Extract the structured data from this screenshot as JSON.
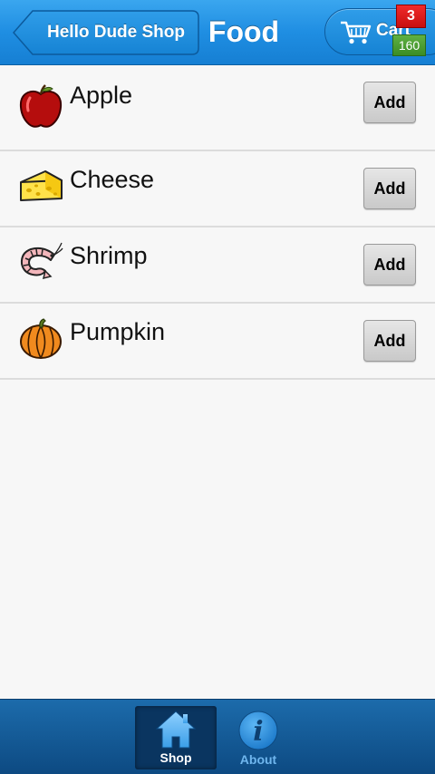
{
  "header": {
    "back_label": "Hello Dude Shop",
    "title": "Food",
    "cart_label": "Cart",
    "cart_count": "3",
    "cart_total": "160"
  },
  "items": [
    {
      "name": "Apple",
      "add_label": "Add",
      "icon": "apple-icon"
    },
    {
      "name": "Cheese",
      "add_label": "Add",
      "icon": "cheese-icon"
    },
    {
      "name": "Shrimp",
      "add_label": "Add",
      "icon": "shrimp-icon"
    },
    {
      "name": "Pumpkin",
      "add_label": "Add",
      "icon": "pumpkin-icon"
    }
  ],
  "tabs": [
    {
      "label": "Shop",
      "icon": "home-icon",
      "active": true
    },
    {
      "label": "About",
      "icon": "info-icon",
      "active": false
    }
  ],
  "colors": {
    "header_blue": "#1f8ee2",
    "tabbar_blue": "#0d4a82",
    "badge_red": "#d81414",
    "badge_green": "#4a9c31"
  }
}
